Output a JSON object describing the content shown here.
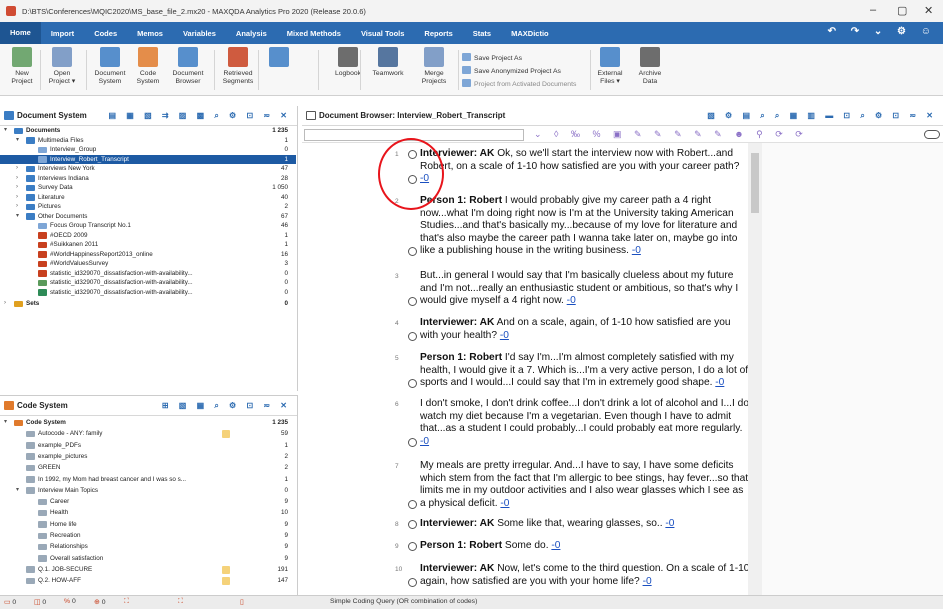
{
  "window": {
    "title": "D:\\BTS\\Conferences\\MQIC2020\\MS_base_file_2.mx20 - MAXQDA Analytics Pro 2020 (Release 20.0.6)",
    "min_glyph": "–",
    "max_glyph": "▢",
    "close_glyph": "✕"
  },
  "menu": [
    "Home",
    "Import",
    "Codes",
    "Memos",
    "Variables",
    "Analysis",
    "Mixed Methods",
    "Visual Tools",
    "Reports",
    "Stats",
    "MAXDictio"
  ],
  "menu_right_icons": "↶ ↷ ⌄ ⚙ ☺",
  "ribbon": {
    "buttons": [
      {
        "label1": "New",
        "label2": "Project",
        "color": "#5b9a5b"
      },
      {
        "label1": "Open",
        "label2": "Project ▾",
        "color": "#6d8fbf"
      },
      {
        "label1": "Document",
        "label2": "System",
        "color": "#3b7dc4"
      },
      {
        "label1": "Code",
        "label2": "System",
        "color": "#e07a2c"
      },
      {
        "label1": "Document",
        "label2": "Browser",
        "color": "#3b7dc4"
      },
      {
        "label1": "Retrieved",
        "label2": "Segments",
        "color": "#c8401f"
      },
      {
        "label1": "",
        "label2": "",
        "color": "#3b7dc4"
      },
      {
        "label1": "Logbook",
        "label2": "",
        "color": "#555555"
      },
      {
        "label1": "Teamwork",
        "label2": "",
        "color": "#3a5f8f"
      },
      {
        "label1": "Merge",
        "label2": "Projects",
        "color": "#6d8fbf"
      },
      {
        "label1": "External",
        "label2": "Files ▾",
        "color": "#3b7dc4"
      },
      {
        "label1": "Archive",
        "label2": "Data",
        "color": "#555555"
      }
    ],
    "small": [
      "Save Project As",
      "Save Anonymized Project As",
      "Project from Activated Documents"
    ]
  },
  "docsys": {
    "title": "Document System",
    "tools": "▤ ▦ ▧ ⇉ ▨ ▩ ⌕ ⚙ ⊡ ≂ ✕",
    "rows": [
      {
        "label": "Documents",
        "count": "1 235",
        "indent": 0,
        "arrow": "▾",
        "icon": "folder",
        "bold": true
      },
      {
        "label": "Multimedia Files",
        "count": "1",
        "indent": 1,
        "arrow": "▾",
        "icon": "folder"
      },
      {
        "label": "Interview_Group",
        "count": "0",
        "indent": 2,
        "arrow": "",
        "icon": "doc"
      },
      {
        "label": "Interview_Robert_Transcript",
        "count": "1",
        "indent": 2,
        "arrow": "",
        "icon": "doc",
        "selected": true
      },
      {
        "label": "Interviews New York",
        "count": "47",
        "indent": 1,
        "arrow": "›",
        "icon": "folder"
      },
      {
        "label": "Interviews Indiana",
        "count": "28",
        "indent": 1,
        "arrow": "›",
        "icon": "folder"
      },
      {
        "label": "Survey Data",
        "count": "1 050",
        "indent": 1,
        "arrow": "›",
        "icon": "folder"
      },
      {
        "label": "Literature",
        "count": "40",
        "indent": 1,
        "arrow": "›",
        "icon": "folder"
      },
      {
        "label": "Pictures",
        "count": "2",
        "indent": 1,
        "arrow": "›",
        "icon": "folder"
      },
      {
        "label": "Other Documents",
        "count": "67",
        "indent": 1,
        "arrow": "▾",
        "icon": "folder"
      },
      {
        "label": "Focus Group Transcript No.1",
        "count": "46",
        "indent": 2,
        "arrow": "",
        "icon": "doc"
      },
      {
        "label": "#OECD 2009",
        "count": "1",
        "indent": 2,
        "arrow": "",
        "icon": "pdf"
      },
      {
        "label": "#Suikkanen 2011",
        "count": "1",
        "indent": 2,
        "arrow": "",
        "icon": "pdf"
      },
      {
        "label": "#WorldHappinessReport2013_online",
        "count": "16",
        "indent": 2,
        "arrow": "",
        "icon": "pdf"
      },
      {
        "label": "#WorldValuesSurvey",
        "count": "3",
        "indent": 2,
        "arrow": "",
        "icon": "pdf"
      },
      {
        "label": "statistic_id329070_dissatisfaction-with-availability...",
        "count": "0",
        "indent": 2,
        "arrow": "",
        "icon": "pdf"
      },
      {
        "label": "statistic_id329070_dissatisfaction-with-availability...",
        "count": "0",
        "indent": 2,
        "arrow": "",
        "icon": "img"
      },
      {
        "label": "statistic_id329070_dissatisfaction-with-availability...",
        "count": "0",
        "indent": 2,
        "arrow": "",
        "icon": "xls"
      },
      {
        "label": "Sets",
        "count": "0",
        "indent": 0,
        "arrow": "›",
        "icon": "sets",
        "bold": true
      }
    ]
  },
  "codesys": {
    "title": "Code System",
    "tools": "⊞ ▧ ▦ ⌕ ⚙ ⊡ ≂ ✕",
    "rows": [
      {
        "label": "Code System",
        "count": "1 235",
        "indent": 0,
        "arrow": "▾",
        "bold": true,
        "swatch": ""
      },
      {
        "label": "Autocode - ANY: family",
        "count": "59",
        "indent": 1,
        "arrow": "",
        "swatch": "#f5d27a"
      },
      {
        "label": "example_PDFs",
        "count": "1",
        "indent": 1,
        "arrow": "",
        "swatch": ""
      },
      {
        "label": "example_pictures",
        "count": "2",
        "indent": 1,
        "arrow": "",
        "swatch": ""
      },
      {
        "label": "GREEN",
        "count": "2",
        "indent": 1,
        "arrow": "",
        "swatch": ""
      },
      {
        "label": "In 1992, my Mom had breast cancer and I was so s...",
        "count": "1",
        "indent": 1,
        "arrow": "",
        "swatch": ""
      },
      {
        "label": "Interview Main Topics",
        "count": "0",
        "indent": 1,
        "arrow": "▾",
        "swatch": ""
      },
      {
        "label": "Career",
        "count": "9",
        "indent": 2,
        "arrow": "",
        "swatch": ""
      },
      {
        "label": "Health",
        "count": "10",
        "indent": 2,
        "arrow": "",
        "swatch": ""
      },
      {
        "label": "Home life",
        "count": "9",
        "indent": 2,
        "arrow": "",
        "swatch": ""
      },
      {
        "label": "Recreation",
        "count": "9",
        "indent": 2,
        "arrow": "",
        "swatch": ""
      },
      {
        "label": "Relationships",
        "count": "9",
        "indent": 2,
        "arrow": "",
        "swatch": ""
      },
      {
        "label": "Overall satisfaction",
        "count": "9",
        "indent": 2,
        "arrow": "",
        "swatch": ""
      },
      {
        "label": "Q.1. JOB-SECURE",
        "count": "191",
        "indent": 1,
        "arrow": "",
        "swatch": "#f5d27a"
      },
      {
        "label": "Q.2. HOW-AFF",
        "count": "147",
        "indent": 1,
        "arrow": "",
        "swatch": "#f5d27a"
      }
    ]
  },
  "browser": {
    "title": "Document Browser: Interview_Robert_Transcript",
    "tools": "▧ ⚙ ▤ ⌕ ⌕ ▦ ▥ ▬ ⊡ ⌕ ⚙ ⊡ ≂ ✕",
    "toolbar_icons": "⌄ ◊ ‰ % ▣ ✎ ✎ ✎ ✎ ✎ ☻ ⚲ ⟳ ⟳",
    "link": "-0",
    "paragraphs": [
      {
        "num": "1",
        "speaker": "Interviewer: AK",
        "text": " Ok, so we'll start the interview now with Robert...and Robert, on a scale of 1-10 how satisfied are you with your career path? "
      },
      {
        "num": "2",
        "speaker": "Person 1: Robert",
        "text": " I would probably give my career path a 4 right now...what I'm doing right now is I'm at the University taking American Studies...and that's basically my...because of my love for literature and that's also maybe the career path I wanna take later on, maybe go into like a publishing house in the writing business. "
      },
      {
        "num": "3",
        "speaker": "",
        "text": "But...in general I would say that I'm basically clueless about my future and I'm not...really an enthusiastic student or ambitious, so that's why I would give myself a 4 right now. "
      },
      {
        "num": "4",
        "speaker": "Interviewer: AK",
        "text": " And on a scale, again, of 1-10 how satisfied are you with your health? "
      },
      {
        "num": "5",
        "speaker": "Person 1: Robert",
        "text": " I'd say I'm...I'm almost completely satisfied with my health, I would give it a 7. Which is...I'm a very active person, I do a lot of sports and I would...I could say that I'm in extremely good shape. "
      },
      {
        "num": "6",
        "speaker": "",
        "text": "I don't smoke, I don't drink coffee...I don't drink a lot of alcohol and I...I do watch my diet because I'm a vegetarian. Even though I have to admit that...as a student I could probably...I could probably eat more regularly. "
      },
      {
        "num": "7",
        "speaker": "",
        "text": "My meals are pretty irregular. And...I have to say, I have some deficits which stem from the fact that I'm allergic to bee stings, hay fever...so that limits me in my outdoor activities and I also wear glasses which I see as a physical deficit. "
      },
      {
        "num": "8",
        "speaker": "Interviewer: AK",
        "text": " Some like that, wearing glasses, so.. "
      },
      {
        "num": "9",
        "speaker": "Person 1: Robert",
        "text": " Some do. "
      },
      {
        "num": "10",
        "speaker": "Interviewer: AK",
        "text": " Now, let's come to the third question. On a scale of 1-10 again, how satisfied are you with your home life? "
      }
    ]
  },
  "status": [
    {
      "icon": "▭",
      "value": "0"
    },
    {
      "icon": "◫",
      "value": "0"
    },
    {
      "icon": "%",
      "value": "0"
    },
    {
      "icon": "⊕",
      "value": "0"
    },
    {
      "icon": "⛶",
      "value": ""
    },
    {
      "icon": "⛶",
      "value": ""
    },
    {
      "icon": "▯",
      "value": ""
    }
  ],
  "status_query": "Simple Coding Query (OR combination of codes)"
}
